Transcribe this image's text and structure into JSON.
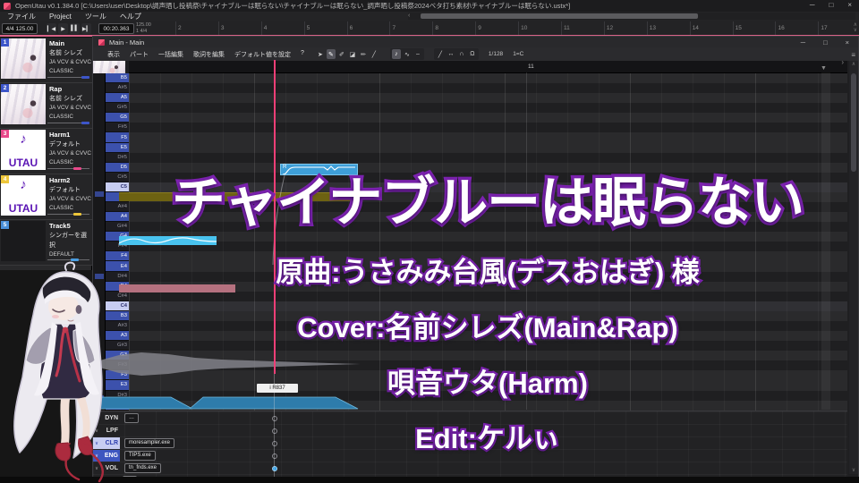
{
  "titlebar": {
    "app_title": "OpenUtau v0.1.384.0 [C:\\Users\\user\\Desktop\\調声晒し投稿祭\\チャイナブルーは眠らない\\チャイナブルーは眠らない_調声晒し投稿祭2024ベタ打ち素材\\チャイナブルーは眠らない.ustx*]",
    "controls": {
      "minimize": "─",
      "maximize": "□",
      "close": "×"
    }
  },
  "menubar": {
    "items": [
      "ファイル",
      "Project",
      "ツール",
      "ヘルプ"
    ]
  },
  "transport": {
    "meter_tempo": "4/4   125.00",
    "time": "00:20.363",
    "buttons": [
      {
        "name": "rewind",
        "glyph": "▎◀"
      },
      {
        "name": "play",
        "glyph": "▶"
      },
      {
        "name": "pause",
        "glyph": "▌▌"
      },
      {
        "name": "forward",
        "glyph": "▶▎"
      }
    ],
    "timeline_tempo": "125.00",
    "timeline_meter": "1 4/4",
    "bars": [
      "2",
      "3",
      "4",
      "5",
      "6",
      "7",
      "8",
      "9",
      "10",
      "11",
      "12",
      "13",
      "14",
      "15",
      "16",
      "17"
    ],
    "scroll_left": "‹",
    "scroll_up": "∧",
    "scroll_down": "∨"
  },
  "tracks": [
    {
      "num": "1",
      "name": "Main",
      "singer": "名前 シレズ",
      "phonemizer": "JA VCV & CVVC",
      "renderer": "CLASSIC",
      "badge": "#3d56c9",
      "avatar": "anime",
      "color": "#3d56c9",
      "pos": "80%"
    },
    {
      "num": "2",
      "name": "Rap",
      "singer": "名前 シレズ",
      "phonemizer": "JA VCV & CVVC",
      "renderer": "CLASSIC",
      "badge": "#3d56c9",
      "avatar": "anime",
      "color": "#3d56c9",
      "pos": "80%"
    },
    {
      "num": "3",
      "name": "Harm1",
      "singer": "デフォルト",
      "phonemizer": "JA VCV & CVVC",
      "renderer": "CLASSIC",
      "badge": "#e8488a",
      "avatar": "utau",
      "color": "#e8488a",
      "pos": "62%"
    },
    {
      "num": "4",
      "name": "Harm2",
      "singer": "デフォルト",
      "phonemizer": "JA VCV & CVVC",
      "renderer": "CLASSIC",
      "badge": "#edc63a",
      "avatar": "utau",
      "color": "#edc63a",
      "pos": "62%"
    },
    {
      "num": "5",
      "name": "Track5",
      "singer": "シンガーを選択",
      "phonemizer": "",
      "renderer": "DEFAULT",
      "badge": "#4a90d9",
      "avatar": "none",
      "color": "#4a9de0",
      "pos": "55%"
    }
  ],
  "utau_logo": {
    "note": "♪",
    "word": "UTAU"
  },
  "pianoroll": {
    "window_title": "Main - Main",
    "controls": {
      "minimize": "─",
      "maximize": "□",
      "close": "×"
    },
    "menus": [
      "表示",
      "パート",
      "一括編集",
      "歌詞を編集",
      "デフォルト値を設定",
      "?"
    ],
    "tools": [
      {
        "name": "pointer-tool",
        "glyph": "➤",
        "on": false
      },
      {
        "name": "pencil-tool",
        "glyph": "✎",
        "on": true
      },
      {
        "name": "pen-tool",
        "glyph": "✐",
        "on": false
      },
      {
        "name": "eraser-tool",
        "glyph": "◪",
        "on": false
      },
      {
        "name": "pen-plus-tool",
        "glyph": "✏",
        "on": false
      },
      {
        "name": "draw-tool",
        "glyph": "╱",
        "on": false
      }
    ],
    "view_tools": [
      {
        "name": "note-view-toggle",
        "glyph": "♪",
        "on": true
      },
      {
        "name": "pitch-view-toggle",
        "glyph": "∿",
        "on": false
      },
      {
        "name": "curve-view-toggle",
        "glyph": "⌢",
        "on": false
      }
    ],
    "snap_tools": [
      {
        "name": "quantize-tool",
        "glyph": "╱",
        "on": false
      },
      {
        "name": "width-tool",
        "glyph": "↔",
        "on": false
      },
      {
        "name": "arc-tool",
        "glyph": "∩",
        "on": false
      },
      {
        "name": "magnet-tool",
        "glyph": "Ω",
        "on": false
      }
    ],
    "resolution": "1/128",
    "key_mode": "1=C",
    "ruler_bar": "11",
    "collapse_arrow": "›",
    "expr_panel_icon": "≡",
    "hover_marker": "▼",
    "scroll_up": "∧",
    "scroll_down": "∨",
    "keys": [
      {
        "label": "B5",
        "cls": "w"
      },
      {
        "label": "A#5",
        "cls": "b"
      },
      {
        "label": "A5",
        "cls": "w"
      },
      {
        "label": "G#5",
        "cls": "b"
      },
      {
        "label": "G5",
        "cls": "w"
      },
      {
        "label": "F#5",
        "cls": "b"
      },
      {
        "label": "F5",
        "cls": "w"
      },
      {
        "label": "E5",
        "cls": "w"
      },
      {
        "label": "D#5",
        "cls": "b"
      },
      {
        "label": "D5",
        "cls": "w"
      },
      {
        "label": "C#5",
        "cls": "b"
      },
      {
        "label": "C5",
        "cls": "hl"
      },
      {
        "label": "B4",
        "cls": "w"
      },
      {
        "label": "A#4",
        "cls": "b"
      },
      {
        "label": "A4",
        "cls": "w"
      },
      {
        "label": "G#4",
        "cls": "b"
      },
      {
        "label": "G4",
        "cls": "w"
      },
      {
        "label": "F#4",
        "cls": "b"
      },
      {
        "label": "F4",
        "cls": "w"
      },
      {
        "label": "E4",
        "cls": "w"
      },
      {
        "label": "D#4",
        "cls": "b"
      },
      {
        "label": "D4",
        "cls": "w"
      },
      {
        "label": "C#4",
        "cls": "b"
      },
      {
        "label": "C4",
        "cls": "hl"
      },
      {
        "label": "B3",
        "cls": "w"
      },
      {
        "label": "A#3",
        "cls": "b"
      },
      {
        "label": "A3",
        "cls": "w"
      },
      {
        "label": "G#3",
        "cls": "b"
      },
      {
        "label": "G3",
        "cls": "w"
      },
      {
        "label": "F#3",
        "cls": "b"
      },
      {
        "label": "F3",
        "cls": "w"
      },
      {
        "label": "E3",
        "cls": "w"
      },
      {
        "label": "D#3",
        "cls": "b"
      },
      {
        "label": "D3",
        "cls": "w"
      }
    ],
    "notes": {
      "r_label": "R",
      "part_label": "i R837"
    },
    "expressions": [
      {
        "abbr": "DYN",
        "button": "…",
        "state": "",
        "point": "hollow"
      },
      {
        "abbr": "LPF",
        "button": "",
        "state": "",
        "point": "hollow"
      },
      {
        "abbr": "CLR",
        "button": "moresampler.exe",
        "state": "sel-light",
        "point": "hollow"
      },
      {
        "abbr": "ENG",
        "button": "TIPS.exe",
        "state": "sel-blue",
        "point": "hollow"
      },
      {
        "abbr": "VOL",
        "button": "tn_fnds.exe",
        "state": "",
        "point": "filled"
      }
    ],
    "footer": {
      "gear": "⚙",
      "button": "…"
    }
  },
  "overlay": {
    "title": "チャイナブルーは眠らない",
    "credits": [
      "原曲:うさみみ台風(デスおはぎ) 様",
      "Cover:名前シレズ(Main&Rap)",
      "唄音ウタ(Harm)",
      "Edit:ケルぃ"
    ]
  }
}
